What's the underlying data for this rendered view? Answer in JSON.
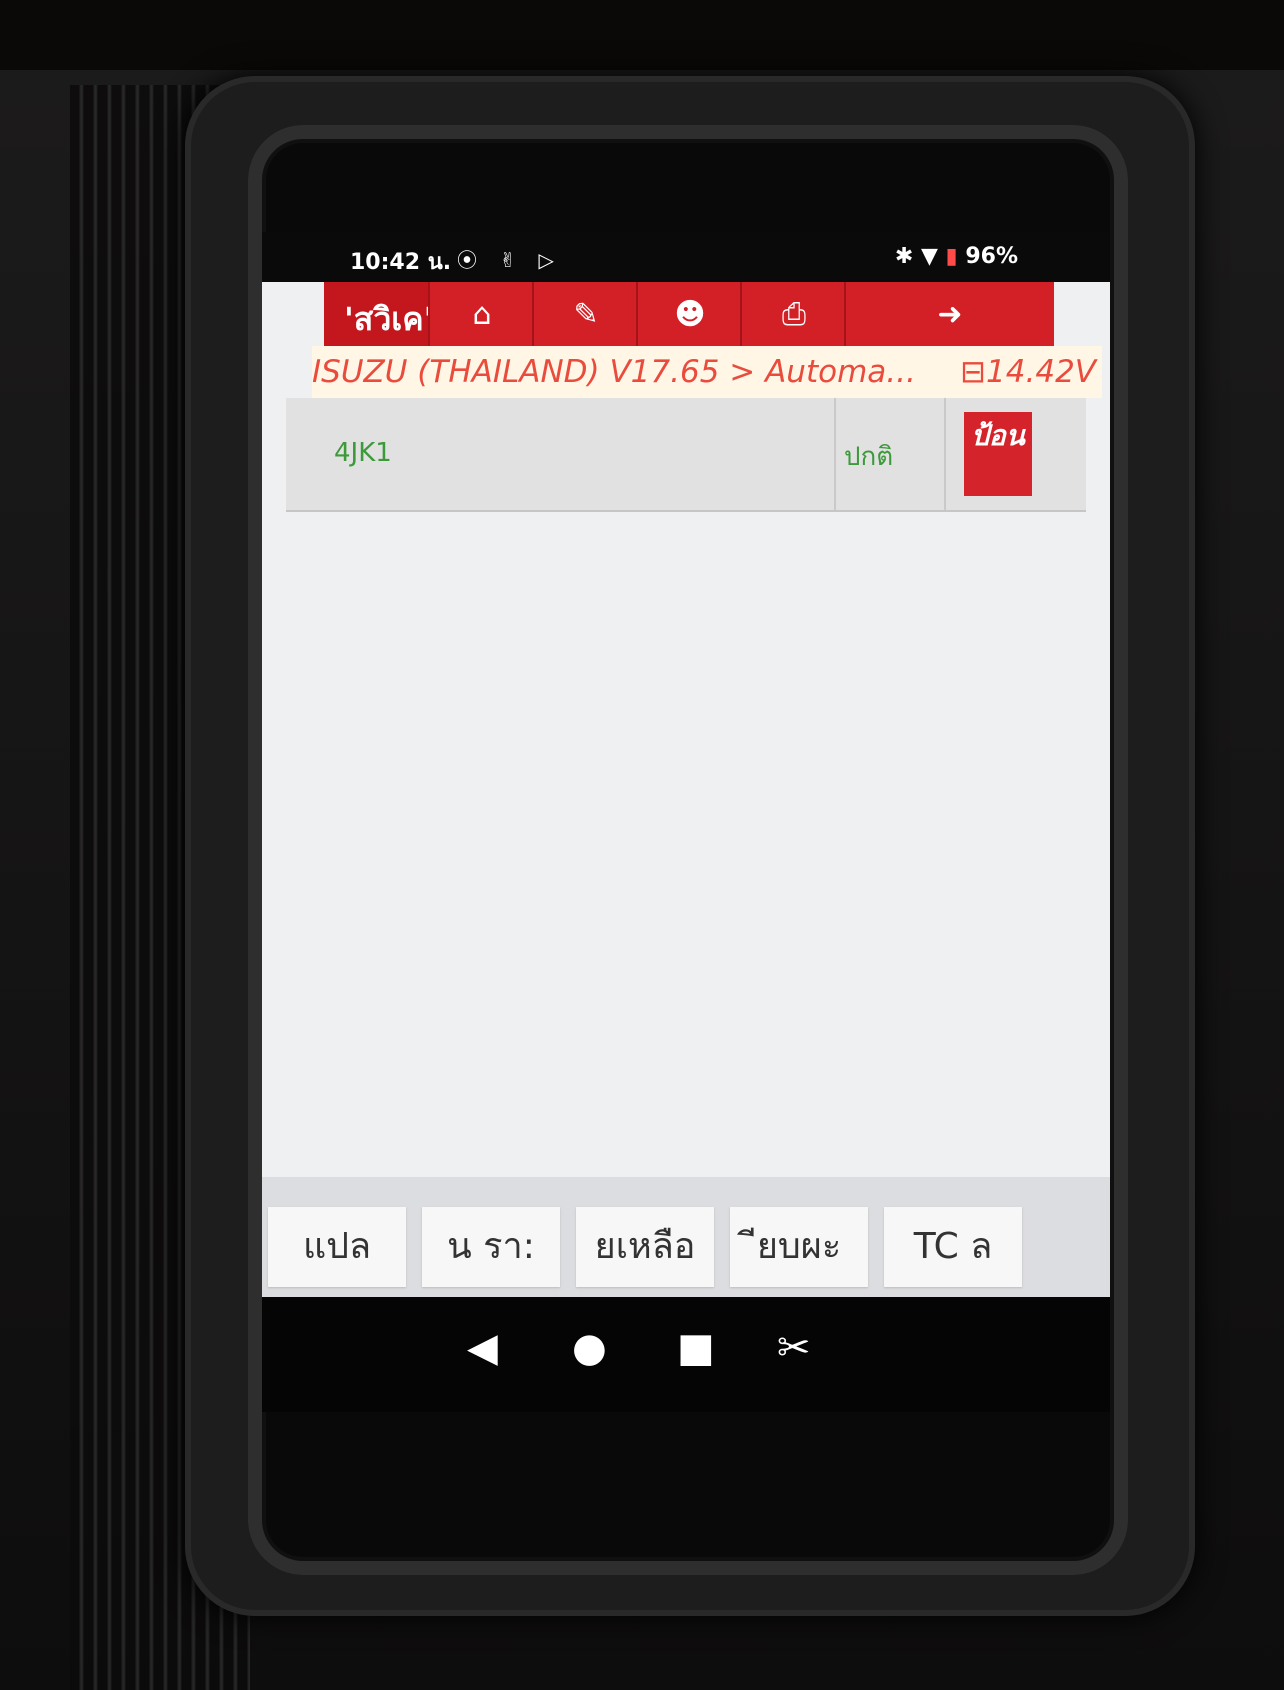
{
  "status_bar": {
    "time": "10:42 น.",
    "left_icons": "⦿ ✌ ▷",
    "right_icons": "✱ ▼",
    "battery": "96%"
  },
  "title_bar": {
    "title": "'สวิเค'",
    "buttons": [
      {
        "icon": "home-icon",
        "glyph": "⌂"
      },
      {
        "icon": "edit-icon",
        "glyph": "✎"
      },
      {
        "icon": "support-icon",
        "glyph": "☻"
      },
      {
        "icon": "print-icon",
        "glyph": "⎙"
      },
      {
        "icon": "exit-icon",
        "glyph": "➜"
      }
    ]
  },
  "breadcrumb": {
    "path": "ISUZU (THAILAND) V17.65 > Automa...",
    "voltage": "14.42V"
  },
  "row": {
    "name": "4JK1",
    "status": "ปกติ",
    "enter_label": "ป้อน"
  },
  "bottom_buttons": [
    "แปล",
    "น   รา:",
    "ยเหลือ",
    "ียบผะ",
    "TC   ล"
  ],
  "nav_bar": {
    "back": "◀",
    "home": "●",
    "recent": "■",
    "screenshot": "✂"
  },
  "colors": {
    "brand_red": "#c4171d",
    "status_green": "#3d9a3a",
    "breadcrumb_text": "#e94b3c"
  }
}
